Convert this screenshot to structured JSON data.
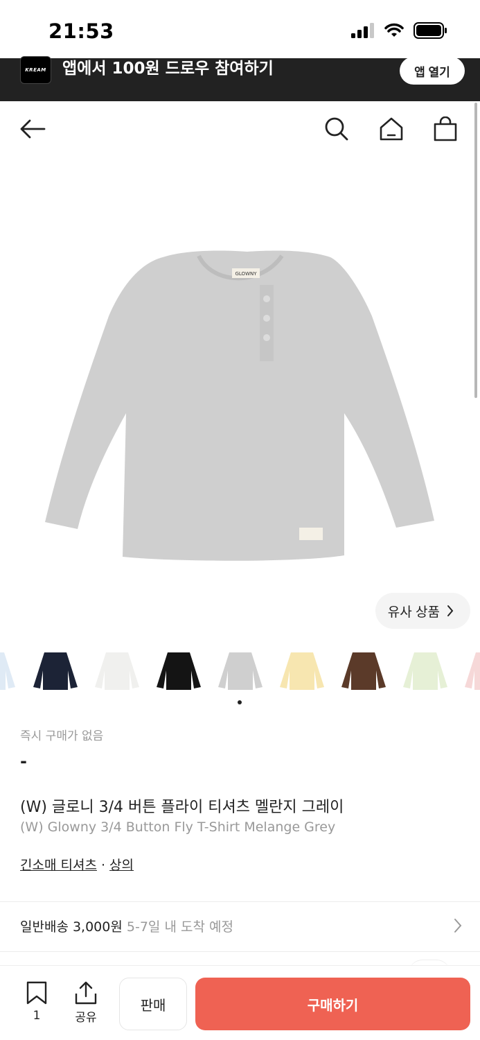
{
  "status_bar": {
    "time": "21:53"
  },
  "banner": {
    "logo_text": "KREAM",
    "text": "앱에서 100원 드로우 참여하기",
    "button_label": "앱 열기"
  },
  "nav": {
    "icons": [
      "back-arrow-icon",
      "search-icon",
      "home-icon",
      "shopping-bag-icon"
    ]
  },
  "product": {
    "image_brand_label": "GLOWNY",
    "similar_button_label": "유사 상품",
    "thumbnail_colors": [
      "#dfeaf5",
      "#1c2336",
      "#f0f0ee",
      "#141414",
      "#cfcfcf",
      "#f7e6b0",
      "#5b3a29",
      "#e6f0d6",
      "#f6d8d8"
    ],
    "selected_page": 1
  },
  "price": {
    "label": "즉시 구매가 없음",
    "value": "-"
  },
  "title": {
    "ko": "(W) 글로니 3/4 버튼 플라이 티셔츠 멜란지 그레이",
    "en": "(W) Glowny 3/4 Button Fly T-Shirt Melange Grey"
  },
  "categories": {
    "first": "긴소매 티셔츠",
    "separator": " · ",
    "second": "상의"
  },
  "delivery": {
    "main": "일반배송 3,000원",
    "sub": "5-7일 내 도착 예정"
  },
  "bottom_bar": {
    "bookmark_count": "1",
    "share_label": "공유",
    "sell_label": "판매",
    "buy_label": "구매하기"
  },
  "colors": {
    "accent": "#ef6253",
    "banner_bg": "#222222"
  }
}
